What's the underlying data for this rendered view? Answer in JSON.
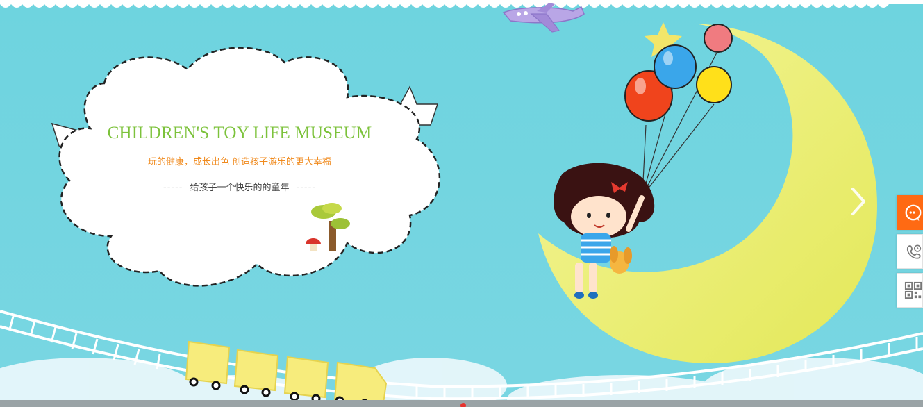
{
  "banner": {
    "headline": "CHILDREN'S TOY LIFE MUSEUM",
    "tagline": "玩的健康，成长出色  创造孩子游乐的更大幸福",
    "slogan": {
      "dash_left": "-----",
      "text": "给孩子一个快乐的的童年",
      "dash_right": "-----"
    }
  },
  "icons": {
    "prev": "chevron-left-icon",
    "next": "chevron-right-icon",
    "service": "headset-icon",
    "phone": "phone-clock-icon",
    "qr": "qr-code-icon"
  },
  "colors": {
    "sky": "#6dd3de",
    "headline": "#7cc23b",
    "tagline": "#f08a1d",
    "service_button": "#ff6a13",
    "moon": "#f2f089"
  }
}
